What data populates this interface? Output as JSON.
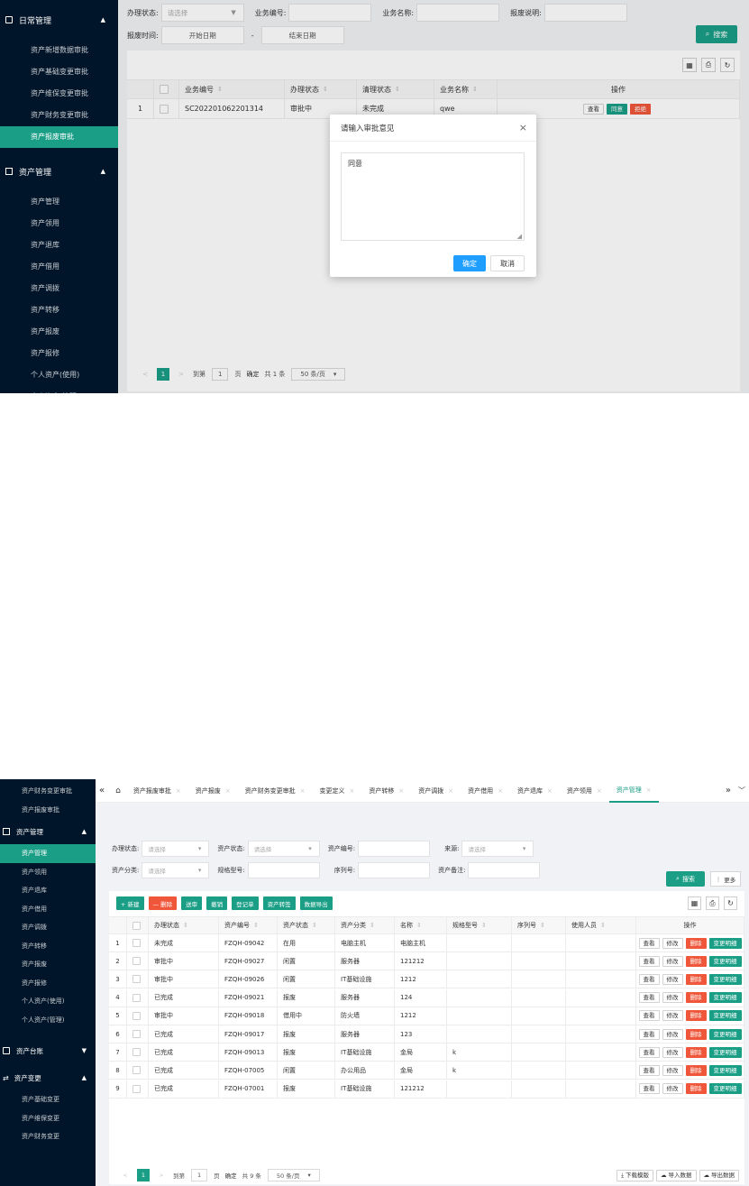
{
  "shot1": {
    "sidebar": {
      "group1": {
        "title": "日常管理",
        "items": [
          "资产新增数据审批",
          "资产基础变更审批",
          "资产维保变更审批",
          "资产财务变更审批",
          "资产报废审批"
        ]
      },
      "group2": {
        "title": "资产管理",
        "items": [
          "资产管理",
          "资产领用",
          "资产退库",
          "资产借用",
          "资产调拨",
          "资产转移",
          "资产报废",
          "资产报修",
          "个人资产(使用)",
          "个人资产(管理)"
        ]
      }
    },
    "filters": {
      "status_label": "办理状态:",
      "status_placeholder": "请选择",
      "biz_no_label": "业务编号:",
      "biz_name_label": "业务名称:",
      "scrap_desc_label": "报废说明:",
      "scrap_time_label": "报废时间:",
      "start_date": "开始日期",
      "dash": "-",
      "end_date": "结束日期",
      "search_btn": "搜索"
    },
    "table": {
      "headers": [
        "业务编号",
        "办理状态",
        "清理状态",
        "业务名称",
        "操作"
      ],
      "rows": [
        {
          "idx": "1",
          "biz_no": "SC202201062201314",
          "status": "审批中",
          "clean": "未完成",
          "name": "qwe"
        }
      ],
      "ops": {
        "view": "查看",
        "agree": "同意",
        "reject": "拒绝"
      }
    },
    "pager": {
      "prev": "<",
      "page": "1",
      "next": ">",
      "goto": "到第",
      "goto_val": "1",
      "page_unit": "页",
      "confirm": "确定",
      "total": "共 1 条",
      "size": "50 条/页"
    },
    "modal": {
      "title": "请输入审批意见",
      "content": "同意",
      "ok": "确定",
      "cancel": "取消",
      "close": "×"
    }
  },
  "shot2": {
    "sidebar": {
      "top_items": [
        "资产财务变更审批",
        "资产报废审批"
      ],
      "group1": {
        "title": "资产管理",
        "items": [
          "资产管理",
          "资产领用",
          "资产退库",
          "资产借用",
          "资产调拨",
          "资产转移",
          "资产报废",
          "资产报修",
          "个人资产(使用)",
          "个人资产(管理)"
        ]
      },
      "group2": {
        "title": "资产台账"
      },
      "group3": {
        "title": "资产变更",
        "items": [
          "资产基础变更",
          "资产维保变更",
          "资产财务变更"
        ]
      }
    },
    "tabs": [
      "资产报废审批",
      "资产报废",
      "资产财务变更审批",
      "变更定义",
      "资产转移",
      "资产调拨",
      "资产借用",
      "资产退库",
      "资产领用",
      "资产管理"
    ],
    "filters": {
      "status_label": "办理状态:",
      "status_ph": "请选择",
      "asset_status_label": "资产状态:",
      "asset_status_ph": "请选择",
      "asset_no_label": "资产编号:",
      "source_label": "来源:",
      "source_ph": "请选择",
      "category_label": "资产分类:",
      "category_ph": "请选择",
      "spec_label": "规格型号:",
      "serial_label": "序列号:",
      "remark_label": "资产备注:",
      "search_btn": "搜索",
      "more_btn": "更多"
    },
    "actions": [
      "+ 新建",
      "— 删除",
      "送审",
      "撤销",
      "登记单",
      "资产转签",
      "数据导出"
    ],
    "table": {
      "headers": [
        "办理状态",
        "资产编号",
        "资产状态",
        "资产分类",
        "名称",
        "规格型号",
        "序列号",
        "使用人员",
        "操作"
      ],
      "rows": [
        [
          "1",
          "未完成",
          "FZQH-09042",
          "在用",
          "电脑主机",
          "电脑主机",
          "",
          "",
          ""
        ],
        [
          "2",
          "审批中",
          "FZQH-09027",
          "闲置",
          "服务器",
          "121212",
          "",
          "",
          ""
        ],
        [
          "3",
          "审批中",
          "FZQH-09026",
          "闲置",
          "IT基础设施",
          "1212",
          "",
          "",
          ""
        ],
        [
          "4",
          "已完成",
          "FZQH-09021",
          "报废",
          "服务器",
          "124",
          "",
          "",
          ""
        ],
        [
          "5",
          "审批中",
          "FZQH-09018",
          "借用中",
          "防火墙",
          "1212",
          "",
          "",
          ""
        ],
        [
          "6",
          "已完成",
          "FZQH-09017",
          "报废",
          "服务器",
          "123",
          "",
          "",
          ""
        ],
        [
          "7",
          "已完成",
          "FZQH-09013",
          "报废",
          "IT基础设施",
          "金局",
          "k",
          "",
          ""
        ],
        [
          "8",
          "已完成",
          "FZQH-07005",
          "闲置",
          "办公用品",
          "金局",
          "k",
          "",
          ""
        ],
        [
          "9",
          "已完成",
          "FZQH-07001",
          "报废",
          "IT基础设施",
          "121212",
          "",
          "",
          ""
        ]
      ],
      "ops": {
        "view": "查看",
        "edit": "修改",
        "del": "删除",
        "change": "变更明细"
      }
    },
    "pager": {
      "prev": "<",
      "page": "1",
      "next": ">",
      "goto": "到第",
      "goto_val": "1",
      "page_unit": "页",
      "confirm": "确定",
      "total": "共 9 条",
      "size": "50 条/页"
    },
    "bottom_btns": [
      "下载模版",
      "导入数据",
      "导出数据"
    ]
  }
}
